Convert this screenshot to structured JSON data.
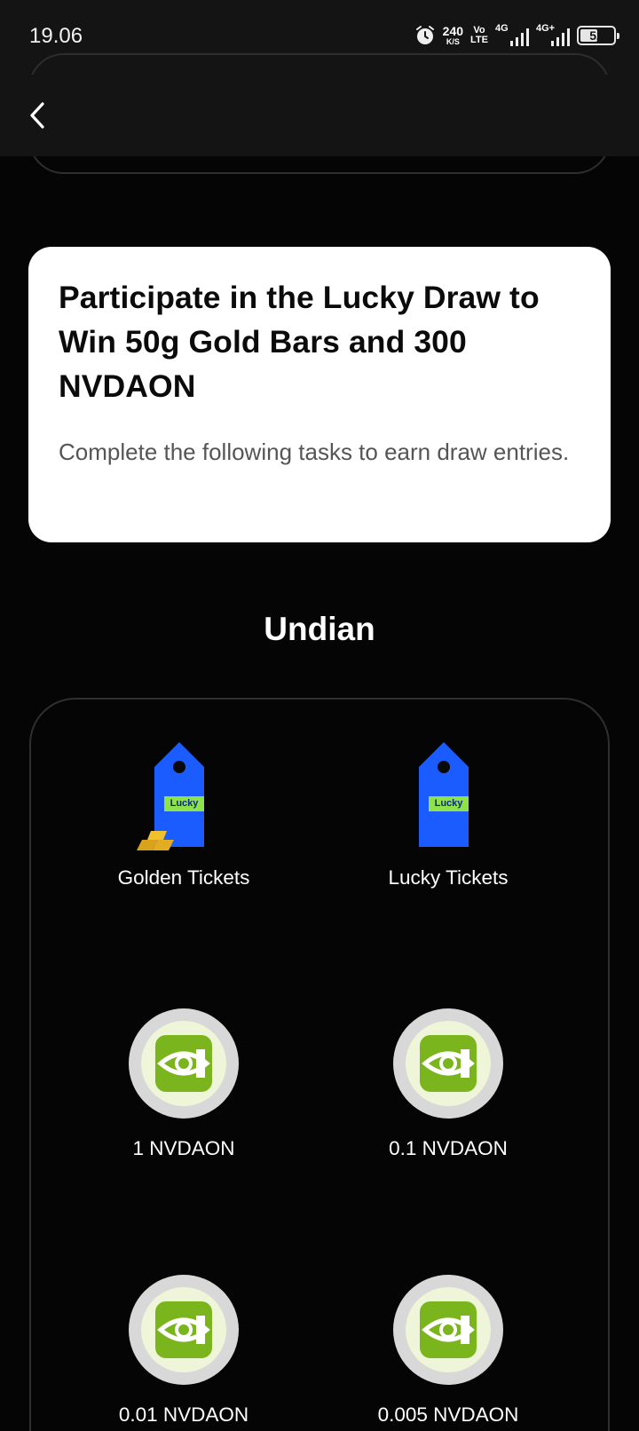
{
  "status_bar": {
    "time": "19.06",
    "net_speed_value": "240",
    "net_speed_unit": "K/S",
    "volte_top": "Vo",
    "volte_bottom": "LTE",
    "sim1_label": "4G",
    "sim2_label": "4G+",
    "battery": "52",
    "battery_level": 0.52
  },
  "promo": {
    "title": "Participate in the Lucky Draw to Win 50g Gold Bars and 300 NVDAON",
    "subtitle": "Complete the following tasks to earn draw entries."
  },
  "section": {
    "title": "Undian"
  },
  "prizes": [
    {
      "label": "Golden Tickets",
      "tag": "Lucky",
      "icon": "golden-ticket-icon"
    },
    {
      "label": "Lucky Tickets",
      "tag": "Lucky",
      "icon": "lucky-ticket-icon"
    },
    {
      "label": "1 NVDAON",
      "icon": "nvdaon-coin-icon"
    },
    {
      "label": "0.1 NVDAON",
      "icon": "nvdaon-coin-icon"
    },
    {
      "label": "0.01 NVDAON",
      "icon": "nvdaon-coin-icon"
    },
    {
      "label": "0.005 NVDAON",
      "icon": "nvdaon-coin-icon"
    }
  ],
  "colors": {
    "ticket_blue": "#1a5cff",
    "ticket_tag_green": "#8fe24a",
    "coin_green": "#7ab51d",
    "background": "#050505"
  }
}
